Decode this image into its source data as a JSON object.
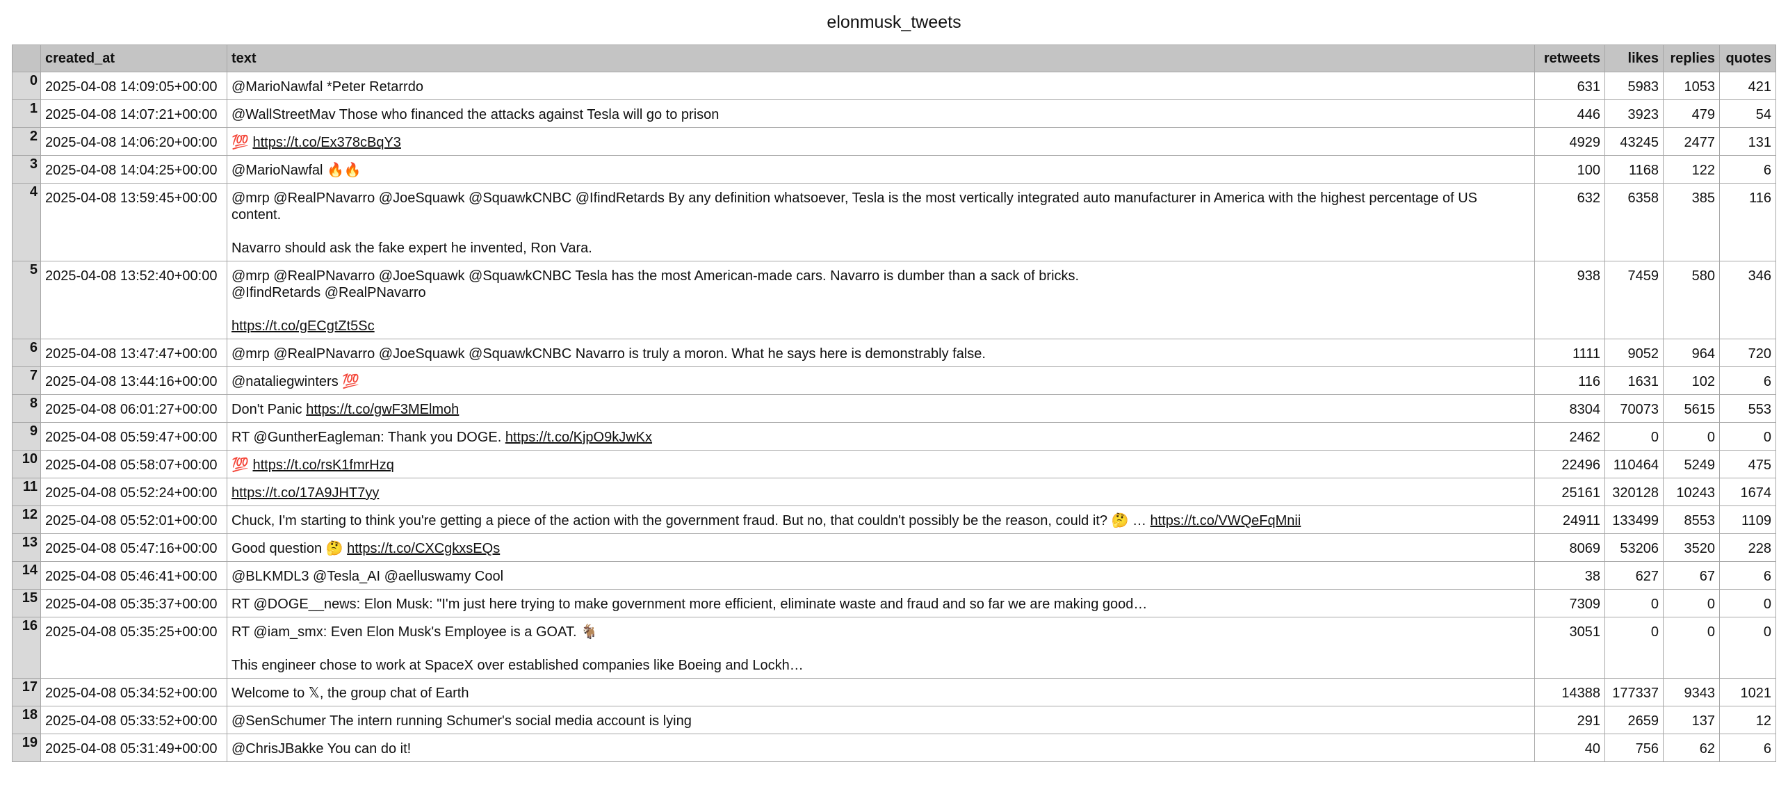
{
  "title": "elonmusk_tweets",
  "columns": [
    "",
    "created_at",
    "text",
    "retweets",
    "likes",
    "replies",
    "quotes"
  ],
  "rows": [
    {
      "idx": "0",
      "created_at": "2025-04-08 14:09:05+00:00",
      "text": [
        {
          "t": "@MarioNawfal *Peter Retarrdo"
        }
      ],
      "retweets": "631",
      "likes": "5983",
      "replies": "1053",
      "quotes": "421"
    },
    {
      "idx": "1",
      "created_at": "2025-04-08 14:07:21+00:00",
      "text": [
        {
          "t": "@WallStreetMav Those who financed the attacks against Tesla will go to prison"
        }
      ],
      "retweets": "446",
      "likes": "3923",
      "replies": "479",
      "quotes": "54"
    },
    {
      "idx": "2",
      "created_at": "2025-04-08 14:06:20+00:00",
      "text": [
        {
          "t": "💯 "
        },
        {
          "t": "https://t.co/Ex378cBqY3",
          "link": true
        }
      ],
      "retweets": "4929",
      "likes": "43245",
      "replies": "2477",
      "quotes": "131"
    },
    {
      "idx": "3",
      "created_at": "2025-04-08 14:04:25+00:00",
      "text": [
        {
          "t": "@MarioNawfal 🔥🔥"
        }
      ],
      "retweets": "100",
      "likes": "1168",
      "replies": "122",
      "quotes": "6"
    },
    {
      "idx": "4",
      "created_at": "2025-04-08 13:59:45+00:00",
      "text": [
        {
          "t": "@mrp @RealPNavarro @JoeSquawk @SquawkCNBC @IfindRetards By any definition whatsoever, Tesla is the most vertically integrated auto manufacturer in America with the highest percentage of US content.\n\nNavarro should ask the fake expert he invented, Ron Vara."
        }
      ],
      "retweets": "632",
      "likes": "6358",
      "replies": "385",
      "quotes": "116"
    },
    {
      "idx": "5",
      "created_at": "2025-04-08 13:52:40+00:00",
      "text": [
        {
          "t": "@mrp @RealPNavarro @JoeSquawk @SquawkCNBC Tesla has the most American-made cars. Navarro is dumber than a sack of bricks.\n@IfindRetards @RealPNavarro\n\n"
        },
        {
          "t": "https://t.co/gECgtZt5Sc",
          "link": true
        }
      ],
      "retweets": "938",
      "likes": "7459",
      "replies": "580",
      "quotes": "346"
    },
    {
      "idx": "6",
      "created_at": "2025-04-08 13:47:47+00:00",
      "text": [
        {
          "t": "@mrp @RealPNavarro @JoeSquawk @SquawkCNBC Navarro is truly a moron. What he says here is demonstrably false."
        }
      ],
      "retweets": "1111",
      "likes": "9052",
      "replies": "964",
      "quotes": "720"
    },
    {
      "idx": "7",
      "created_at": "2025-04-08 13:44:16+00:00",
      "text": [
        {
          "t": "@nataliegwinters 💯"
        }
      ],
      "retweets": "116",
      "likes": "1631",
      "replies": "102",
      "quotes": "6"
    },
    {
      "idx": "8",
      "created_at": "2025-04-08 06:01:27+00:00",
      "text": [
        {
          "t": "Don't Panic "
        },
        {
          "t": "https://t.co/gwF3MElmoh",
          "link": true
        }
      ],
      "retweets": "8304",
      "likes": "70073",
      "replies": "5615",
      "quotes": "553"
    },
    {
      "idx": "9",
      "created_at": "2025-04-08 05:59:47+00:00",
      "text": [
        {
          "t": "RT @GuntherEagleman: Thank you DOGE. "
        },
        {
          "t": "https://t.co/KjpO9kJwKx",
          "link": true
        }
      ],
      "retweets": "2462",
      "likes": "0",
      "replies": "0",
      "quotes": "0"
    },
    {
      "idx": "10",
      "created_at": "2025-04-08 05:58:07+00:00",
      "text": [
        {
          "t": "💯 "
        },
        {
          "t": "https://t.co/rsK1fmrHzq",
          "link": true
        }
      ],
      "retweets": "22496",
      "likes": "110464",
      "replies": "5249",
      "quotes": "475"
    },
    {
      "idx": "11",
      "created_at": "2025-04-08 05:52:24+00:00",
      "text": [
        {
          "t": "https://t.co/17A9JHT7yy",
          "link": true
        }
      ],
      "retweets": "25161",
      "likes": "320128",
      "replies": "10243",
      "quotes": "1674"
    },
    {
      "idx": "12",
      "created_at": "2025-04-08 05:52:01+00:00",
      "text": [
        {
          "t": "Chuck, I'm starting to think you're getting a piece of the action with the government fraud. But no, that couldn't possibly be the reason, could it? 🤔 … "
        },
        {
          "t": "https://t.co/VWQeFqMnii",
          "link": true
        }
      ],
      "retweets": "24911",
      "likes": "133499",
      "replies": "8553",
      "quotes": "1109"
    },
    {
      "idx": "13",
      "created_at": "2025-04-08 05:47:16+00:00",
      "text": [
        {
          "t": "Good question 🤔 "
        },
        {
          "t": "https://t.co/CXCgkxsEQs",
          "link": true
        }
      ],
      "retweets": "8069",
      "likes": "53206",
      "replies": "3520",
      "quotes": "228"
    },
    {
      "idx": "14",
      "created_at": "2025-04-08 05:46:41+00:00",
      "text": [
        {
          "t": "@BLKMDL3 @Tesla_AI @aelluswamy Cool"
        }
      ],
      "retweets": "38",
      "likes": "627",
      "replies": "67",
      "quotes": "6"
    },
    {
      "idx": "15",
      "created_at": "2025-04-08 05:35:37+00:00",
      "text": [
        {
          "t": "RT @DOGE__news: Elon Musk: \"I'm just here trying to make government more efficient, eliminate waste and fraud and so far we are making good…"
        }
      ],
      "retweets": "7309",
      "likes": "0",
      "replies": "0",
      "quotes": "0"
    },
    {
      "idx": "16",
      "created_at": "2025-04-08 05:35:25+00:00",
      "text": [
        {
          "t": "RT @iam_smx: Even Elon Musk's Employee is a GOAT. 🐐\n\nThis engineer chose to work at SpaceX over established companies like Boeing and Lockh…"
        }
      ],
      "retweets": "3051",
      "likes": "0",
      "replies": "0",
      "quotes": "0"
    },
    {
      "idx": "17",
      "created_at": "2025-04-08 05:34:52+00:00",
      "text": [
        {
          "t": "Welcome to 𝕏, the group chat of Earth"
        }
      ],
      "retweets": "14388",
      "likes": "177337",
      "replies": "9343",
      "quotes": "1021"
    },
    {
      "idx": "18",
      "created_at": "2025-04-08 05:33:52+00:00",
      "text": [
        {
          "t": "@SenSchumer The intern running Schumer's social media account is lying"
        }
      ],
      "retweets": "291",
      "likes": "2659",
      "replies": "137",
      "quotes": "12"
    },
    {
      "idx": "19",
      "created_at": "2025-04-08 05:31:49+00:00",
      "text": [
        {
          "t": "@ChrisJBakke You can do it!"
        }
      ],
      "retweets": "40",
      "likes": "756",
      "replies": "62",
      "quotes": "6"
    }
  ]
}
